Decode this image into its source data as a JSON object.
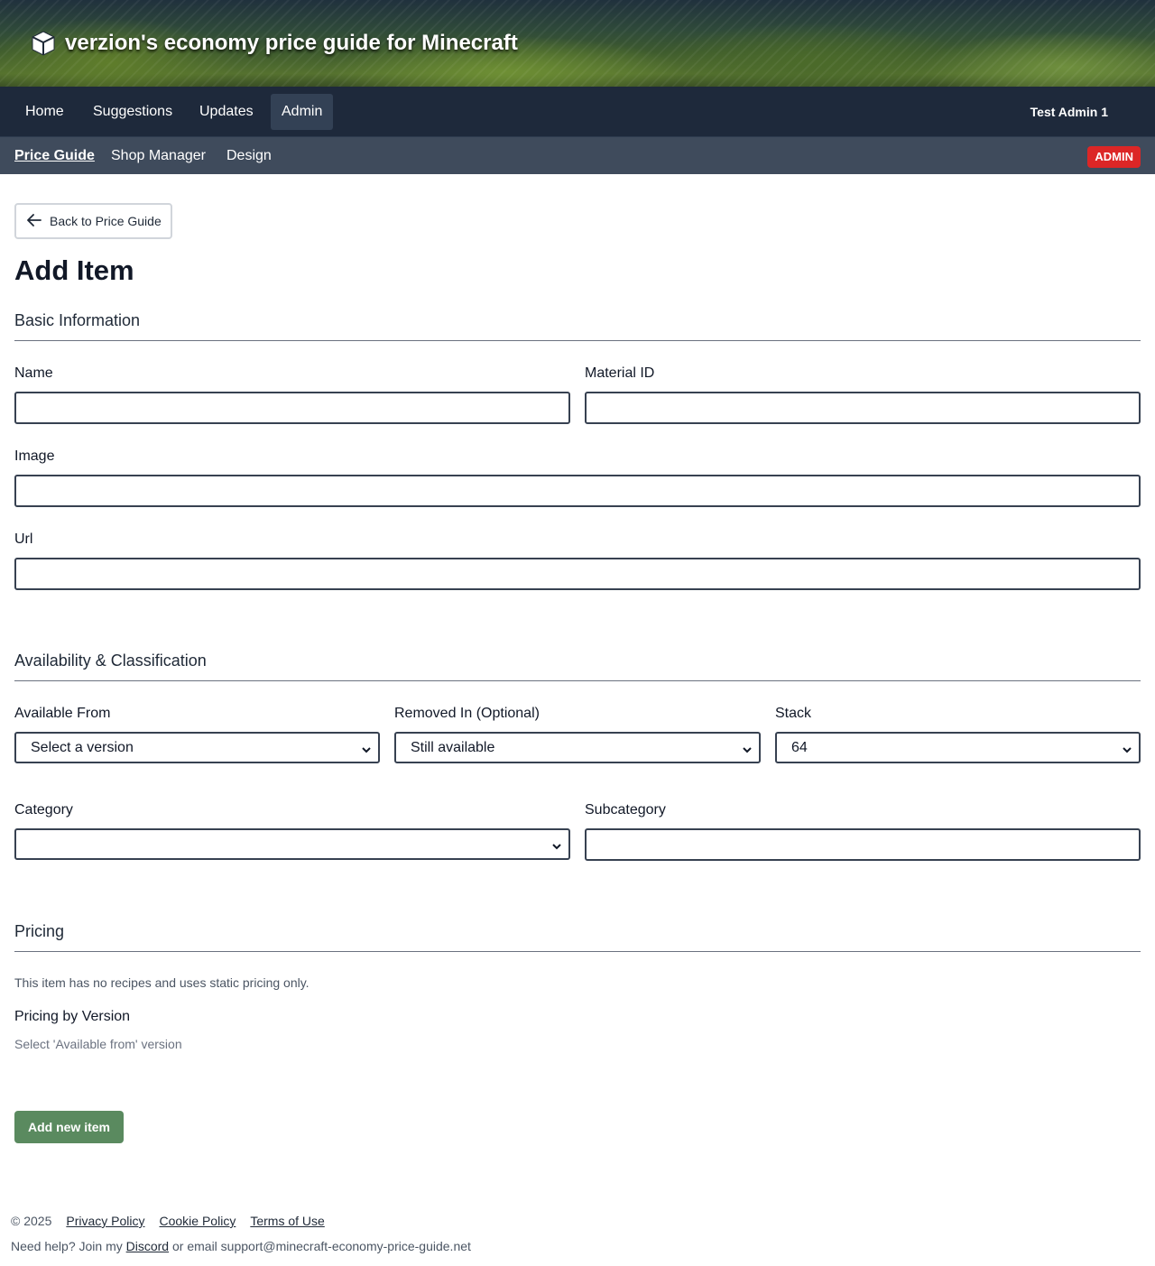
{
  "site": {
    "title": "verzion's economy price guide for Minecraft",
    "logo_icon": "cube-icon"
  },
  "nav": {
    "items": [
      {
        "label": "Home"
      },
      {
        "label": "Suggestions"
      },
      {
        "label": "Updates"
      },
      {
        "label": "Admin",
        "active": true
      }
    ],
    "user": "Test Admin 1"
  },
  "subnav": {
    "items": [
      {
        "label": "Price Guide",
        "active": true
      },
      {
        "label": "Shop Manager"
      },
      {
        "label": "Design"
      }
    ],
    "badge": "ADMIN"
  },
  "page": {
    "back_label": "Back to Price Guide",
    "title": "Add Item"
  },
  "basic": {
    "heading": "Basic Information",
    "name_label": "Name",
    "name_value": "",
    "material_label": "Material ID",
    "material_value": "",
    "image_label": "Image",
    "image_value": "",
    "url_label": "Url",
    "url_value": ""
  },
  "availability": {
    "heading": "Availability & Classification",
    "available_from_label": "Available From",
    "available_from_value": "Select a version",
    "removed_in_label": "Removed In (Optional)",
    "removed_in_value": "Still available",
    "stack_label": "Stack",
    "stack_value": "64",
    "category_label": "Category",
    "category_value": "",
    "subcategory_label": "Subcategory",
    "subcategory_value": ""
  },
  "pricing": {
    "heading": "Pricing",
    "info": "This item has no recipes and uses static pricing only.",
    "by_version_heading": "Pricing by Version",
    "by_version_hint": "Select 'Available from' version"
  },
  "actions": {
    "submit_label": "Add new item"
  },
  "footer": {
    "copyright": "© 2025",
    "links": [
      "Privacy Policy",
      "Cookie Policy",
      "Terms of Use"
    ],
    "help_prefix": "Need help? Join my",
    "discord_label": "Discord",
    "help_suffix": "or email support@minecraft-economy-price-guide.net"
  },
  "colors": {
    "nav_bg": "#1e293b",
    "subnav_bg": "#3f4b5c",
    "badge_bg": "#dc2626",
    "submit_bg": "#5a8a5f"
  }
}
